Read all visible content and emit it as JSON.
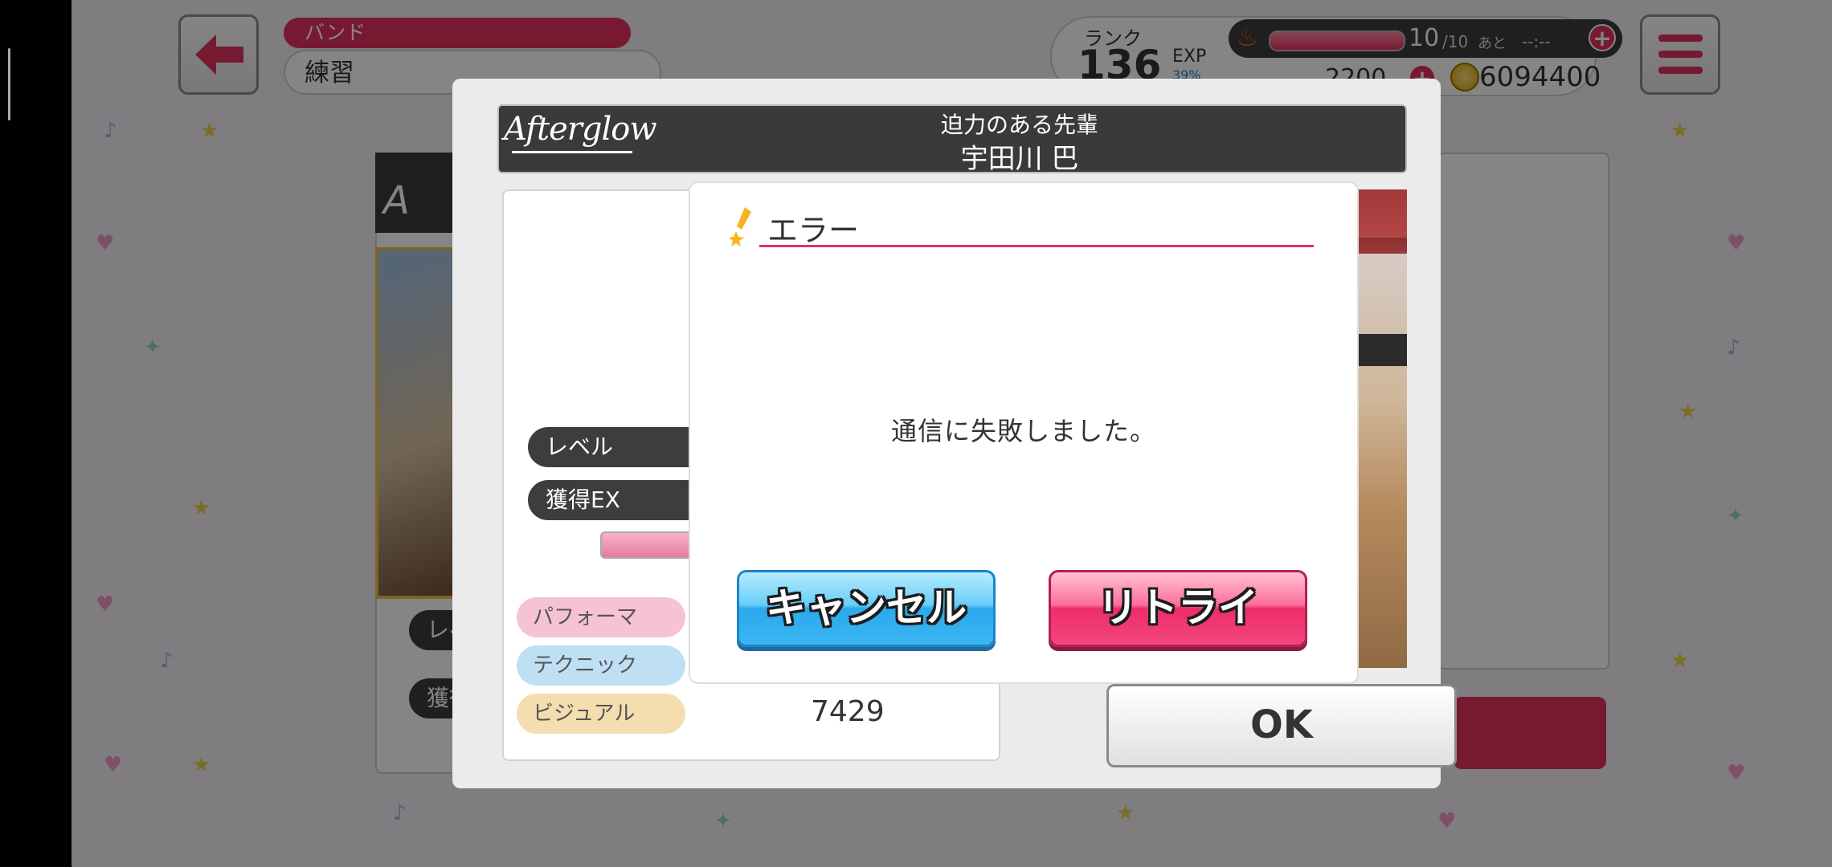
{
  "top_bar": {
    "band_label": "バンド",
    "band_name": "練習",
    "rank_label": "ランク",
    "rank_value": "136",
    "exp_label": "EXP",
    "exp_percent": "39%",
    "stamina_current": "10",
    "stamina_max": "/10",
    "stamina_fraction": 1.0,
    "next_label": "あと",
    "next_time": "--:--",
    "gems": "2200",
    "coins": "6094400"
  },
  "result_dialog": {
    "band_logo": "Afterglow",
    "card_title": "迫力のある先輩",
    "card_name": "宇田川 巴",
    "level_label": "レベル",
    "exp_label": "獲得EX",
    "performance_label": "パフォーマ",
    "technique_label": "テクニック",
    "visual_label": "ビジュアル",
    "visual_value": "7429",
    "ok_label": "OK"
  },
  "background": {
    "level_label": "レベ",
    "gain_label": "獲得"
  },
  "error_dialog": {
    "title": "エラー",
    "message": "通信に失敗しました。",
    "cancel_label": "キャンセル",
    "retry_label": "リトライ"
  },
  "colors": {
    "accent_pink": "#e3315e",
    "cancel_blue": "#3cb5f2",
    "dim_overlay": "rgba(0,0,0,0.48)"
  }
}
